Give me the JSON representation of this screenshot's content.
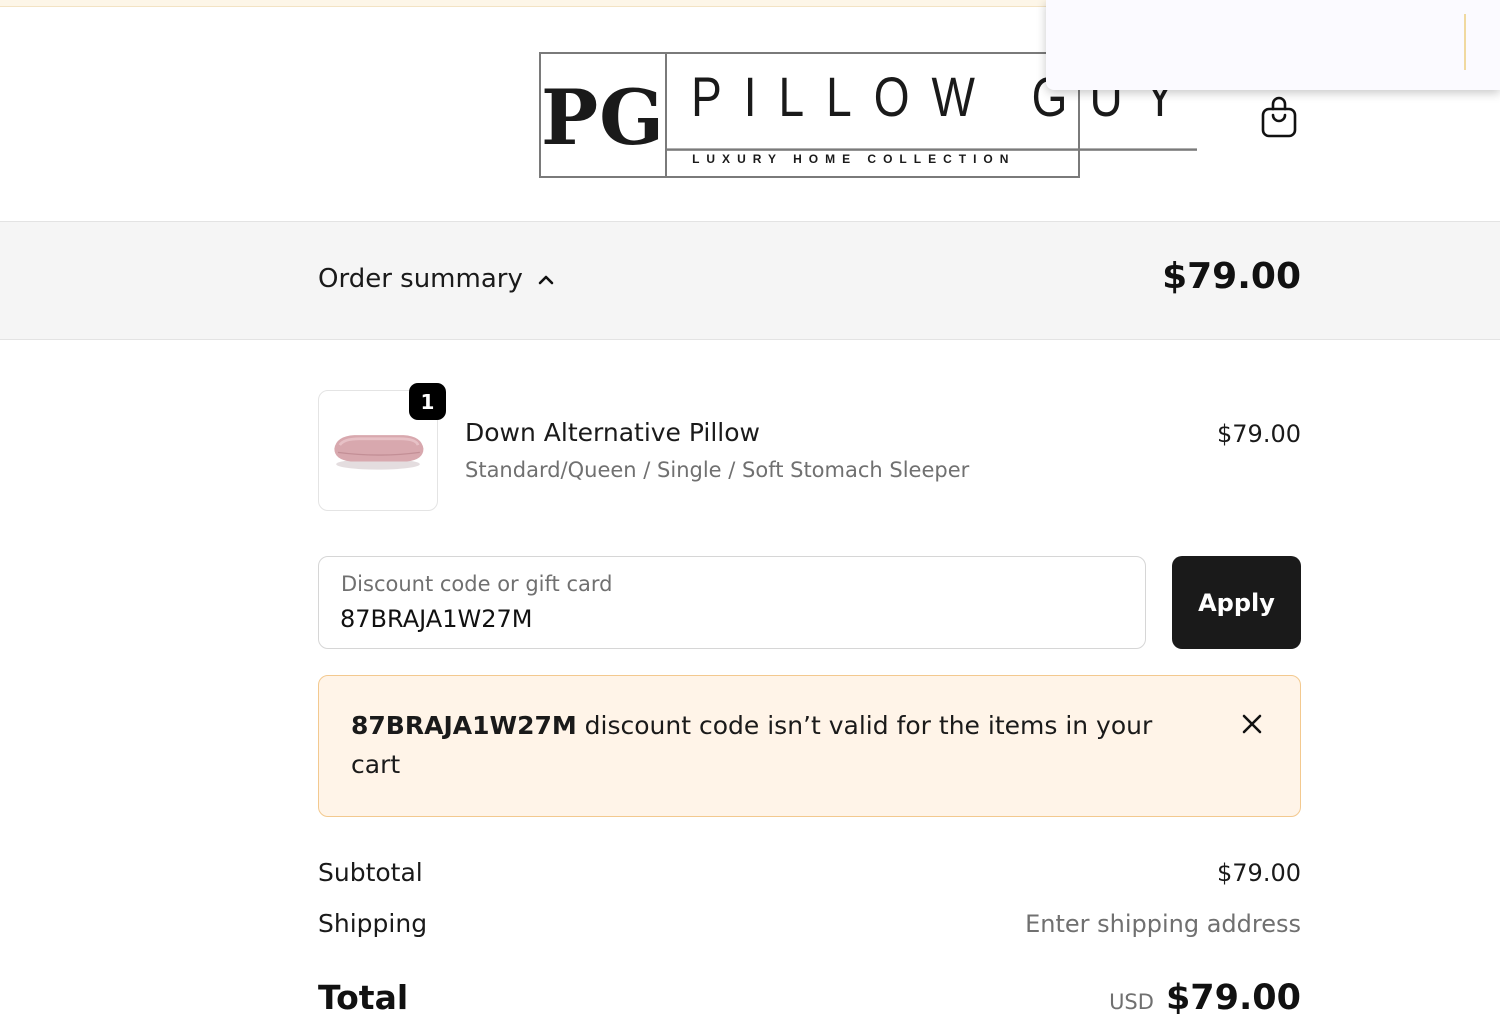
{
  "brand": {
    "monogram": "PG",
    "name": "PILLOW GUY",
    "tagline": "LUXURY HOME COLLECTION"
  },
  "header": {
    "cart_icon": "shopping-bag-icon"
  },
  "order_summary": {
    "toggle_label": "Order summary",
    "toggle_icon": "chevron-up-icon",
    "total": "$79.00"
  },
  "line_items": [
    {
      "quantity": "1",
      "name": "Down Alternative Pillow",
      "variant": "Standard/Queen / Single / Soft Stomach Sleeper",
      "price": "$79.00",
      "image_icon": "pillow-image"
    }
  ],
  "discount": {
    "placeholder": "Discount code or gift card",
    "value": "87BRAJA1W27M",
    "apply_label": "Apply"
  },
  "alert": {
    "code": "87BRAJA1W27M",
    "message": " discount code isn’t valid for the items in your cart",
    "close_icon": "close-icon"
  },
  "totals": {
    "subtotal_label": "Subtotal",
    "subtotal_value": "$79.00",
    "shipping_label": "Shipping",
    "shipping_value": "Enter shipping address",
    "total_label": "Total",
    "currency": "USD",
    "total_value": "$79.00"
  },
  "colors": {
    "alert_background": "#fff4e8",
    "alert_border": "#f3c98f",
    "button": "#1a1a1a",
    "summary_bar": "#f5f5f5"
  }
}
